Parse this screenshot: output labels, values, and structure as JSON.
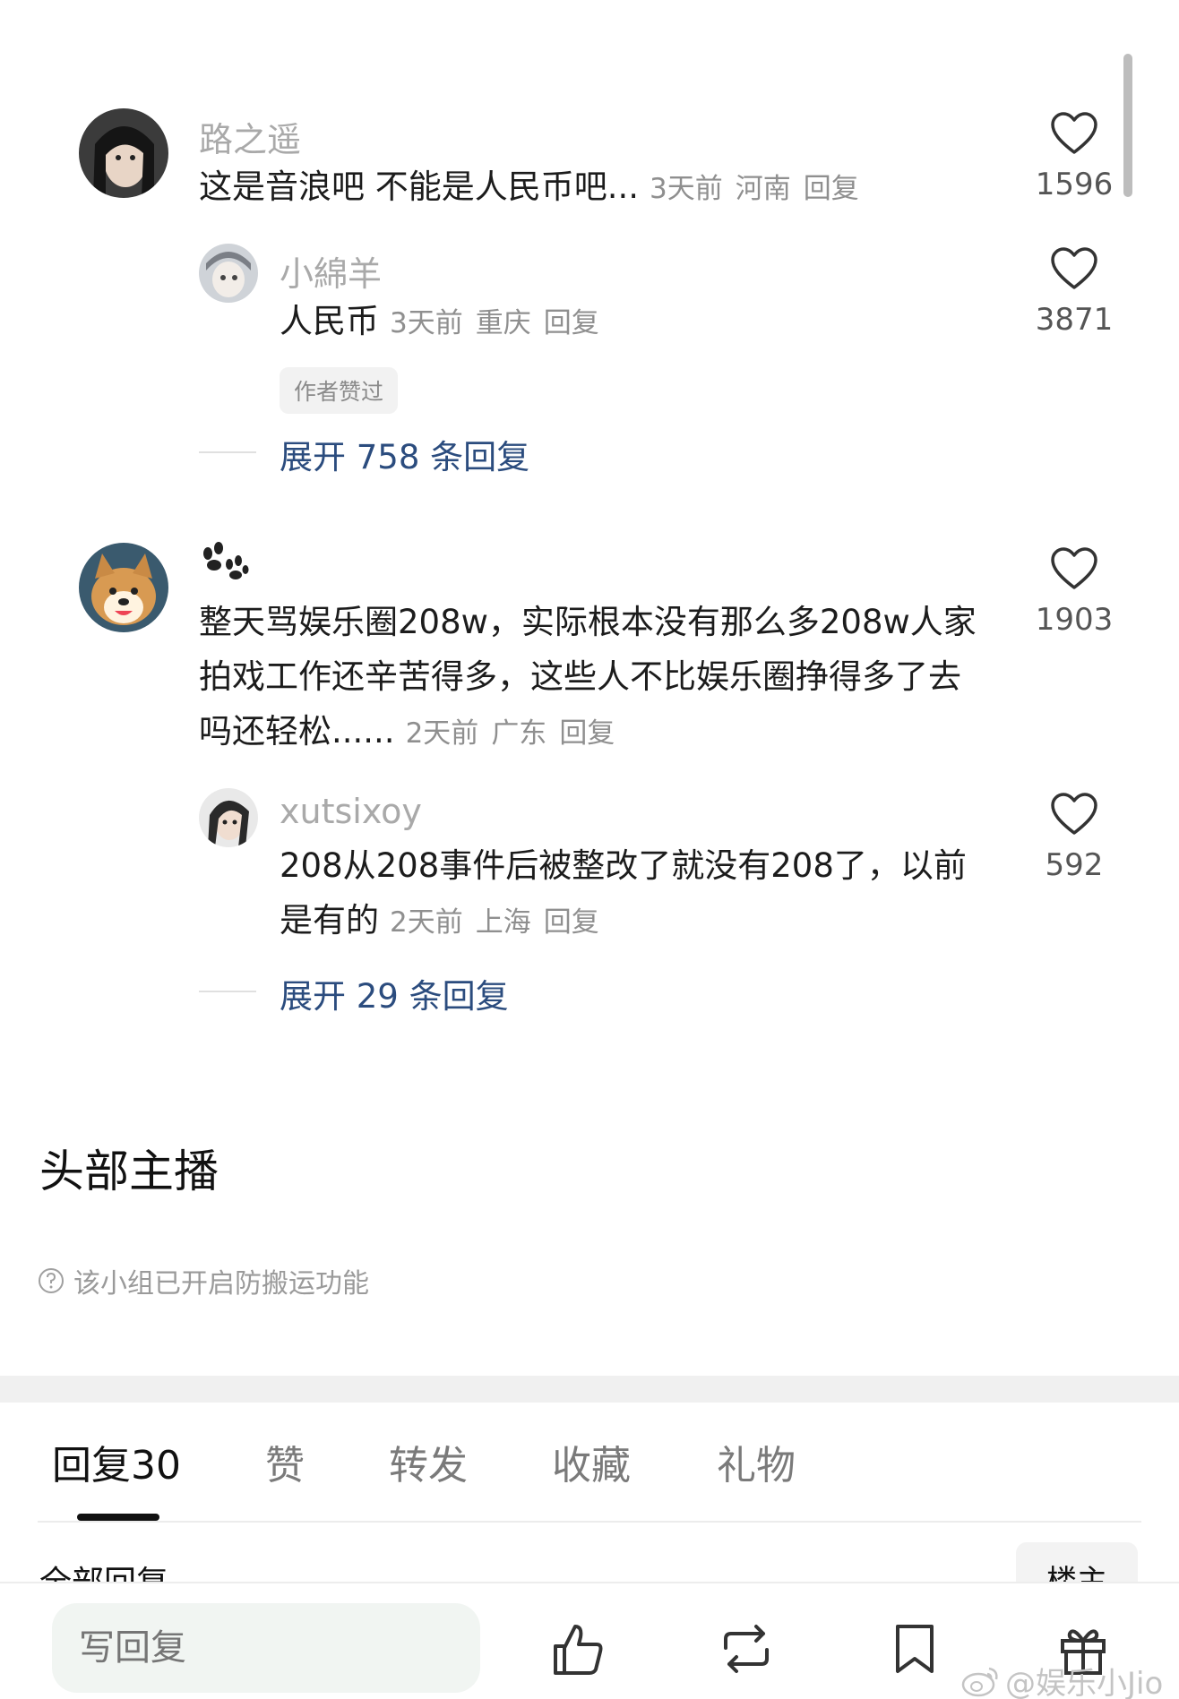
{
  "comments": [
    {
      "username": "路之遥",
      "text": "这是音浪吧 不能是人民币吧...",
      "time": "3天前",
      "location": "河南",
      "reply_label": "回复",
      "likes": "1596"
    },
    {
      "username": "小綿羊",
      "text": "人民币",
      "time": "3天前",
      "location": "重庆",
      "reply_label": "回复",
      "likes": "3871",
      "badge": "作者赞过",
      "expand": "展开 758 条回复"
    },
    {
      "username": "🐾",
      "text": "整天骂娱乐圈208w，实际根本没有那么多208w人家拍戏工作还辛苦得多，这些人不比娱乐圈挣得多了去吗还轻松......",
      "time": "2天前",
      "location": "广东",
      "reply_label": "回复",
      "likes": "1903"
    },
    {
      "username": "xutsixoy",
      "text": "208从208事件后被整改了就没有208了，以前是有的",
      "time": "2天前",
      "location": "上海",
      "reply_label": "回复",
      "likes": "592",
      "expand": "展开 29 条回复"
    }
  ],
  "section_title": "头部主播",
  "notice": "该小组已开启防搬运功能",
  "tabs": [
    {
      "label": "回复30",
      "active": true
    },
    {
      "label": "赞",
      "active": false
    },
    {
      "label": "转发",
      "active": false
    },
    {
      "label": "收藏",
      "active": false
    },
    {
      "label": "礼物",
      "active": false
    }
  ],
  "subheader_left": "全部回复",
  "subheader_right": "楼主",
  "bottom_bar": {
    "reply_placeholder": "写回复",
    "icons": [
      "thumbs-up-icon",
      "repost-icon",
      "bookmark-icon",
      "gift-icon"
    ]
  },
  "watermark": "@娱乐小Jio",
  "colors": {
    "expand_link": "#2b4c7e",
    "muted": "#8f8f8f",
    "divider_band": "#f0f0f0"
  }
}
